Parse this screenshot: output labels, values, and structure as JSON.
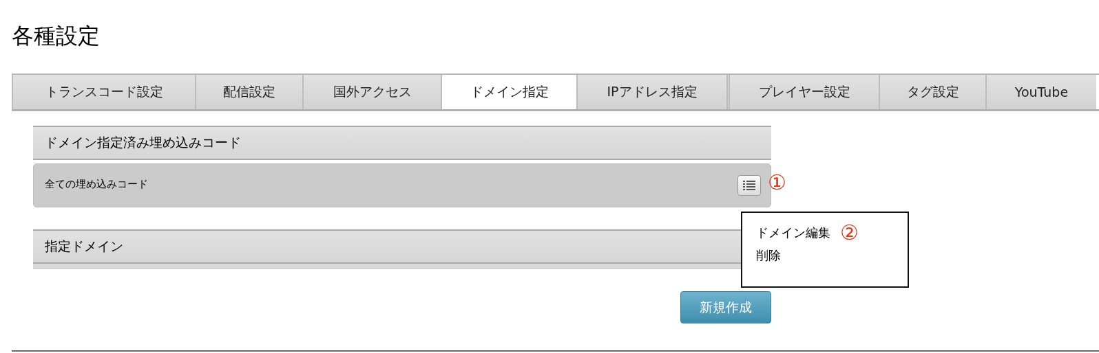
{
  "page_title": "各種設定",
  "tabs": [
    {
      "label": "トランスコード設定",
      "selected": false,
      "group_start": false
    },
    {
      "label": "配信設定",
      "selected": false,
      "group_start": false
    },
    {
      "label": "国外アクセス",
      "selected": false,
      "group_start": false
    },
    {
      "label": "ドメイン指定",
      "selected": true,
      "group_start": false
    },
    {
      "label": "IPアドレス指定",
      "selected": false,
      "group_start": false
    },
    {
      "label": "プレイヤー設定",
      "selected": false,
      "group_start": true
    },
    {
      "label": "タグ設定",
      "selected": false,
      "group_start": false
    },
    {
      "label": "YouTube",
      "selected": false,
      "group_start": false
    }
  ],
  "sections": [
    {
      "header": "ドメイン指定済み埋め込みコード",
      "rows": [
        {
          "label": "全ての埋め込みコード",
          "annotation": "①"
        }
      ]
    },
    {
      "header": "指定ドメイン"
    }
  ],
  "context_menu": {
    "items": [
      {
        "label": "ドメイン編集",
        "annotation": "②"
      },
      {
        "label": "削除"
      }
    ]
  },
  "create_button": "新規作成"
}
